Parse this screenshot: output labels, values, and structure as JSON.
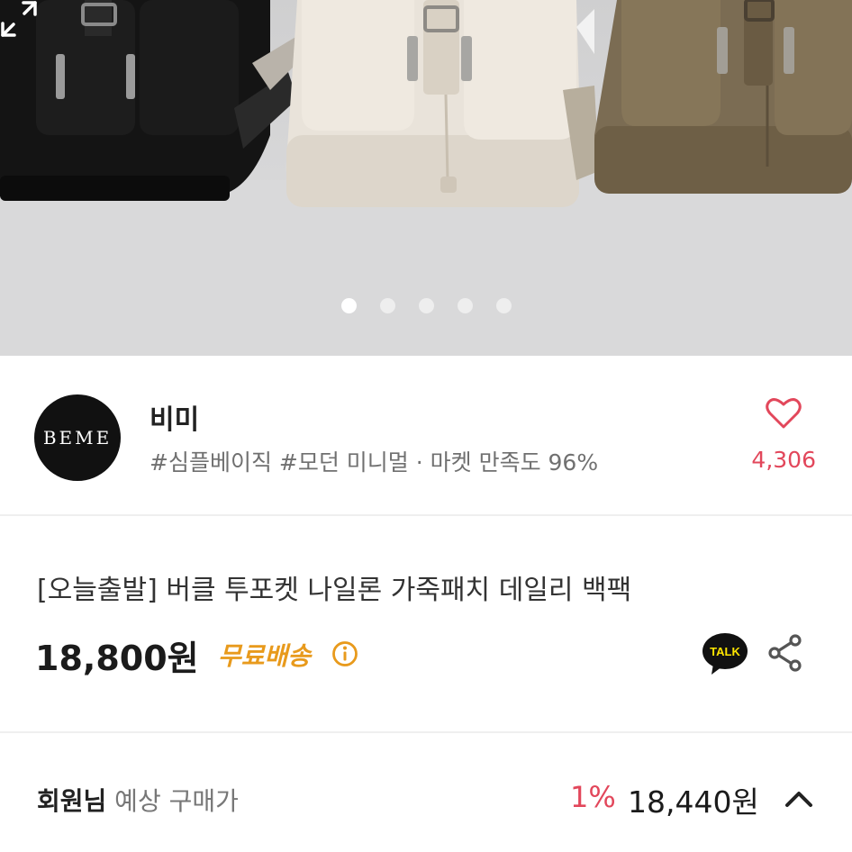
{
  "gallery": {
    "slide_count": 5,
    "active_index": 0,
    "expand_icon": "expand-icon"
  },
  "store": {
    "logo_text": "BEME",
    "name": "비미",
    "meta": "#심플베이직 #모던 미니멀 · 마켓 만족도 96%",
    "like_icon": "heart-icon",
    "like_count": "4,306"
  },
  "product": {
    "title": "[오늘출발] 버클 투포켓 나일론 가죽패치 데일리 백팩",
    "price": "18,800원",
    "shipping": "무료배송",
    "talk_label": "TALK",
    "share_icon": "share-icon"
  },
  "member": {
    "label_bold": "회원님",
    "label": " 예상 구매가",
    "discount": "1%",
    "price": "18,440원"
  },
  "colors": {
    "accent_red": "#e2475b",
    "shipping_orange": "#e89a1c",
    "kakao_yellow": "#fee500"
  }
}
